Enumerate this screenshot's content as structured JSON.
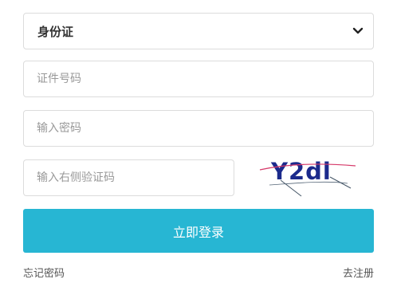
{
  "form": {
    "id_type": {
      "selected": "身份证"
    },
    "id_number": {
      "placeholder": "证件号码"
    },
    "password": {
      "placeholder": "输入密码"
    },
    "captcha": {
      "placeholder": "输入右侧验证码",
      "image_text": "Y2dl"
    },
    "login_button": "立即登录",
    "forgot_password": "忘记密码",
    "register": "去注册"
  },
  "colors": {
    "primary": "#27b6d3",
    "captcha_text": "#1b2a8c",
    "captcha_line": "#d63a6a"
  },
  "icons": {
    "select_arrow": "chevron-down-icon"
  }
}
